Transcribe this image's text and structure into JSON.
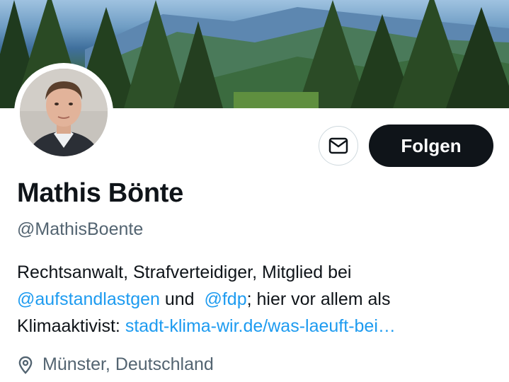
{
  "profile": {
    "name": "Mathis Bönte",
    "handle": "@MathisBoente",
    "follow_label": "Folgen",
    "bio": {
      "line1": "Rechtsanwalt, Strafverteidiger, Mitglied bei",
      "mention1": "@aufstandlastgen",
      "and_word": "und",
      "mention2": "@fdp",
      "line2_rest": "; hier vor allem als",
      "line3_text": "Klimaaktivist: ",
      "url": "stadt-klima-wir.de/was-laeuft-bei…"
    },
    "location": "Münster, Deutschland"
  },
  "icons": {
    "message": "envelope-icon",
    "location": "location-pin-icon"
  },
  "colors": {
    "text": "#0f1419",
    "secondary": "#536471",
    "link": "#1d9bf0",
    "follow_button_bg": "#0f1419"
  }
}
